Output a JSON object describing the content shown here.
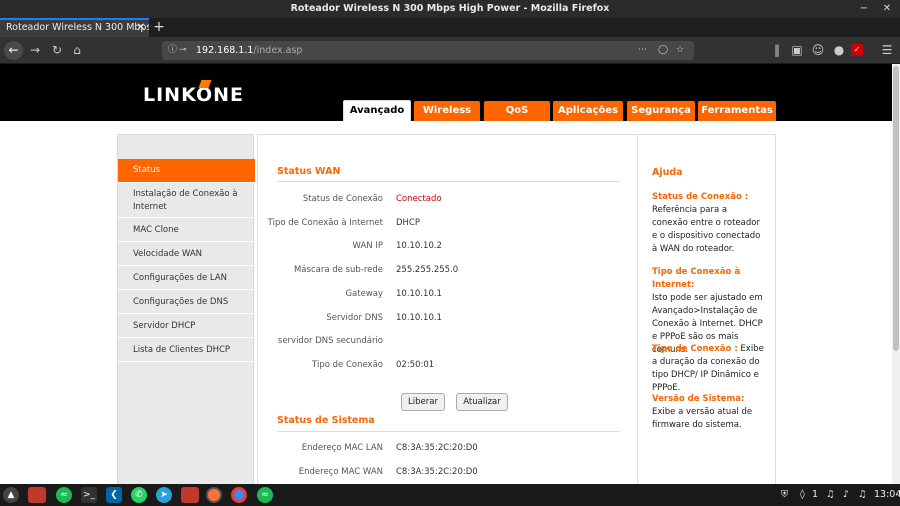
{
  "window": {
    "title": "Roteador Wireless N 300 Mbps High Power - Mozilla Firefox"
  },
  "browser": {
    "tab_title": "Roteador Wireless N 300 Mbps",
    "url_host": "192.168.1.1",
    "url_path": "/index.asp"
  },
  "logo": {
    "text_link": "LINK",
    "text_one": "ONE"
  },
  "main_tabs": [
    "Avançado",
    "Wireless",
    "QoS",
    "Aplicações",
    "Segurança",
    "Ferramentas"
  ],
  "sidebar": {
    "items": [
      "Status",
      "Instalação de Conexão à Internet",
      "MAC Clone",
      "Velocidade WAN",
      "Configurações de LAN",
      "Configurações de DNS",
      "Servidor DHCP",
      "Lista de Clientes DHCP"
    ]
  },
  "wan": {
    "title": "Status WAN",
    "rows": [
      {
        "label": "Status de Conexão",
        "value": "Conectado"
      },
      {
        "label": "Tipo de Conexão à Internet",
        "value": "DHCP"
      },
      {
        "label": "WAN IP",
        "value": "10.10.10.2"
      },
      {
        "label": "Máscara de sub-rede",
        "value": "255.255.255.0"
      },
      {
        "label": "Gateway",
        "value": "10.10.10.1"
      },
      {
        "label": "Servidor DNS",
        "value": "10.10.10.1"
      },
      {
        "label": "servidor DNS secundário",
        "value": ""
      },
      {
        "label": "Tipo de Conexão",
        "value": "02:50:01"
      }
    ],
    "release_label": "Liberar",
    "refresh_label": "Atualizar"
  },
  "system": {
    "title": "Status de Sistema",
    "rows": [
      {
        "label": "Endereço MAC LAN",
        "value": "C8:3A:35:2C:20:D0"
      },
      {
        "label": "Endereço MAC WAN",
        "value": "C8:3A:35:2C:20:D0"
      }
    ]
  },
  "help": {
    "title": "Ajuda",
    "blocks": [
      {
        "heading": "Status de Conexão :",
        "text": "Referência para a conexão entre o roteador e o dispositivo conectado à WAN do roteador."
      },
      {
        "heading": "Tipo de Conexão à Internet:",
        "text": "Isto pode ser ajustado em Avançado>Instalação de Conexão à Internet. DHCP e PPPoE são os mais comuns."
      },
      {
        "heading": "Tipo de Conexão :",
        "text": "Exibe a duração da conexão do tipo DHCP/ IP Dinâmico e PPPoE."
      },
      {
        "heading": "Versão de Sistema:",
        "text": "Exibe a versão atual de firmware do sistema."
      }
    ]
  },
  "taskbar": {
    "workspace": "1",
    "clock": "13:04"
  },
  "colors": {
    "accent": "#ff6600",
    "connected": "#e00000",
    "header": "#000000"
  }
}
